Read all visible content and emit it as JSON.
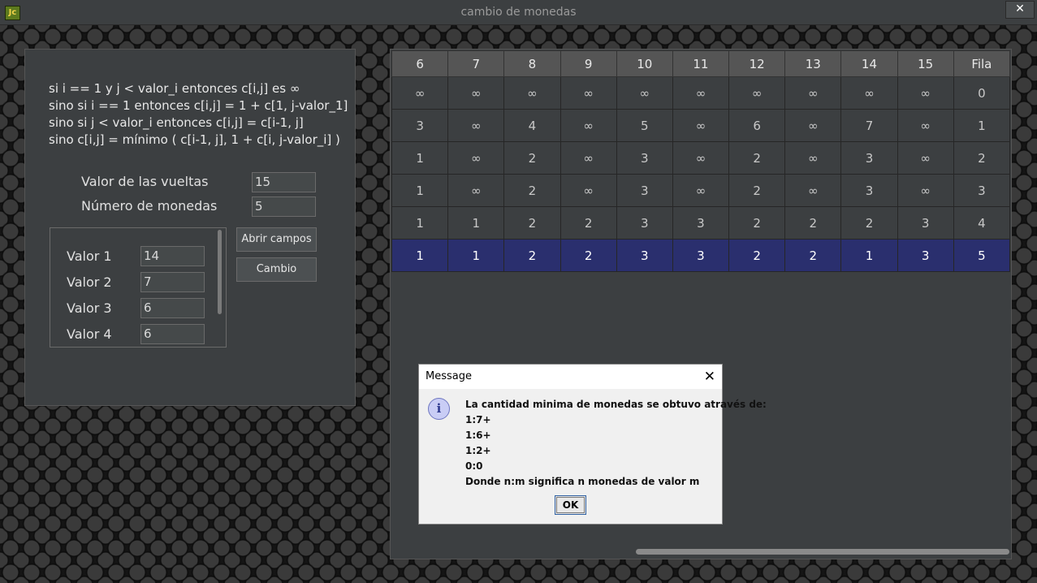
{
  "window": {
    "title": "cambio de monedas",
    "icon_text": "Jc",
    "close_label": "✕"
  },
  "formulas": [
    "si i == 1 y j < valor_i entonces c[i,j] es ∞",
    "sino si i == 1 entonces c[i,j] = 1 + c[1, j-valor_1]",
    "sino si j < valor_i entonces c[i,j] = c[i-1, j]",
    "sino c[i,j] = mínimo ( c[i-1, j], 1 + c[i, j-valor_i] )"
  ],
  "form": {
    "vueltas_label": "Valor de las vueltas",
    "vueltas_value": "15",
    "monedas_label": "Número de monedas",
    "monedas_value": "5",
    "abrir_button": "Abrir campos",
    "cambio_button": "Cambio",
    "valores": [
      {
        "label": "Valor 1",
        "value": "14"
      },
      {
        "label": "Valor 2",
        "value": "7"
      },
      {
        "label": "Valor 3",
        "value": "6"
      },
      {
        "label": "Valor 4",
        "value": "6"
      }
    ]
  },
  "table": {
    "headers": [
      "6",
      "7",
      "8",
      "9",
      "10",
      "11",
      "12",
      "13",
      "14",
      "15",
      "Fila"
    ],
    "rows": [
      [
        "∞",
        "∞",
        "∞",
        "∞",
        "∞",
        "∞",
        "∞",
        "∞",
        "∞",
        "∞",
        "0"
      ],
      [
        "3",
        "∞",
        "4",
        "∞",
        "5",
        "∞",
        "6",
        "∞",
        "7",
        "∞",
        "1"
      ],
      [
        "1",
        "∞",
        "2",
        "∞",
        "3",
        "∞",
        "2",
        "∞",
        "3",
        "∞",
        "2"
      ],
      [
        "1",
        "∞",
        "2",
        "∞",
        "3",
        "∞",
        "2",
        "∞",
        "3",
        "∞",
        "3"
      ],
      [
        "1",
        "1",
        "2",
        "2",
        "3",
        "3",
        "2",
        "2",
        "2",
        "3",
        "4"
      ],
      [
        "1",
        "1",
        "2",
        "2",
        "3",
        "3",
        "2",
        "2",
        "1",
        "3",
        "5"
      ]
    ],
    "selected_row": 5
  },
  "dialog": {
    "title": "Message",
    "close_label": "✕",
    "icon_glyph": "i",
    "lines": [
      "La cantidad minima de monedas se obtuvo através de:",
      "1:7+",
      "1:6+",
      "1:2+",
      "0:0",
      "Donde n:m significa n monedas de valor m"
    ],
    "ok_label": "OK"
  },
  "colors": {
    "panel": "#3c3f41",
    "selection": "#2a2f6e",
    "header": "#555555",
    "dialog_bg": "#f0f0f0"
  }
}
